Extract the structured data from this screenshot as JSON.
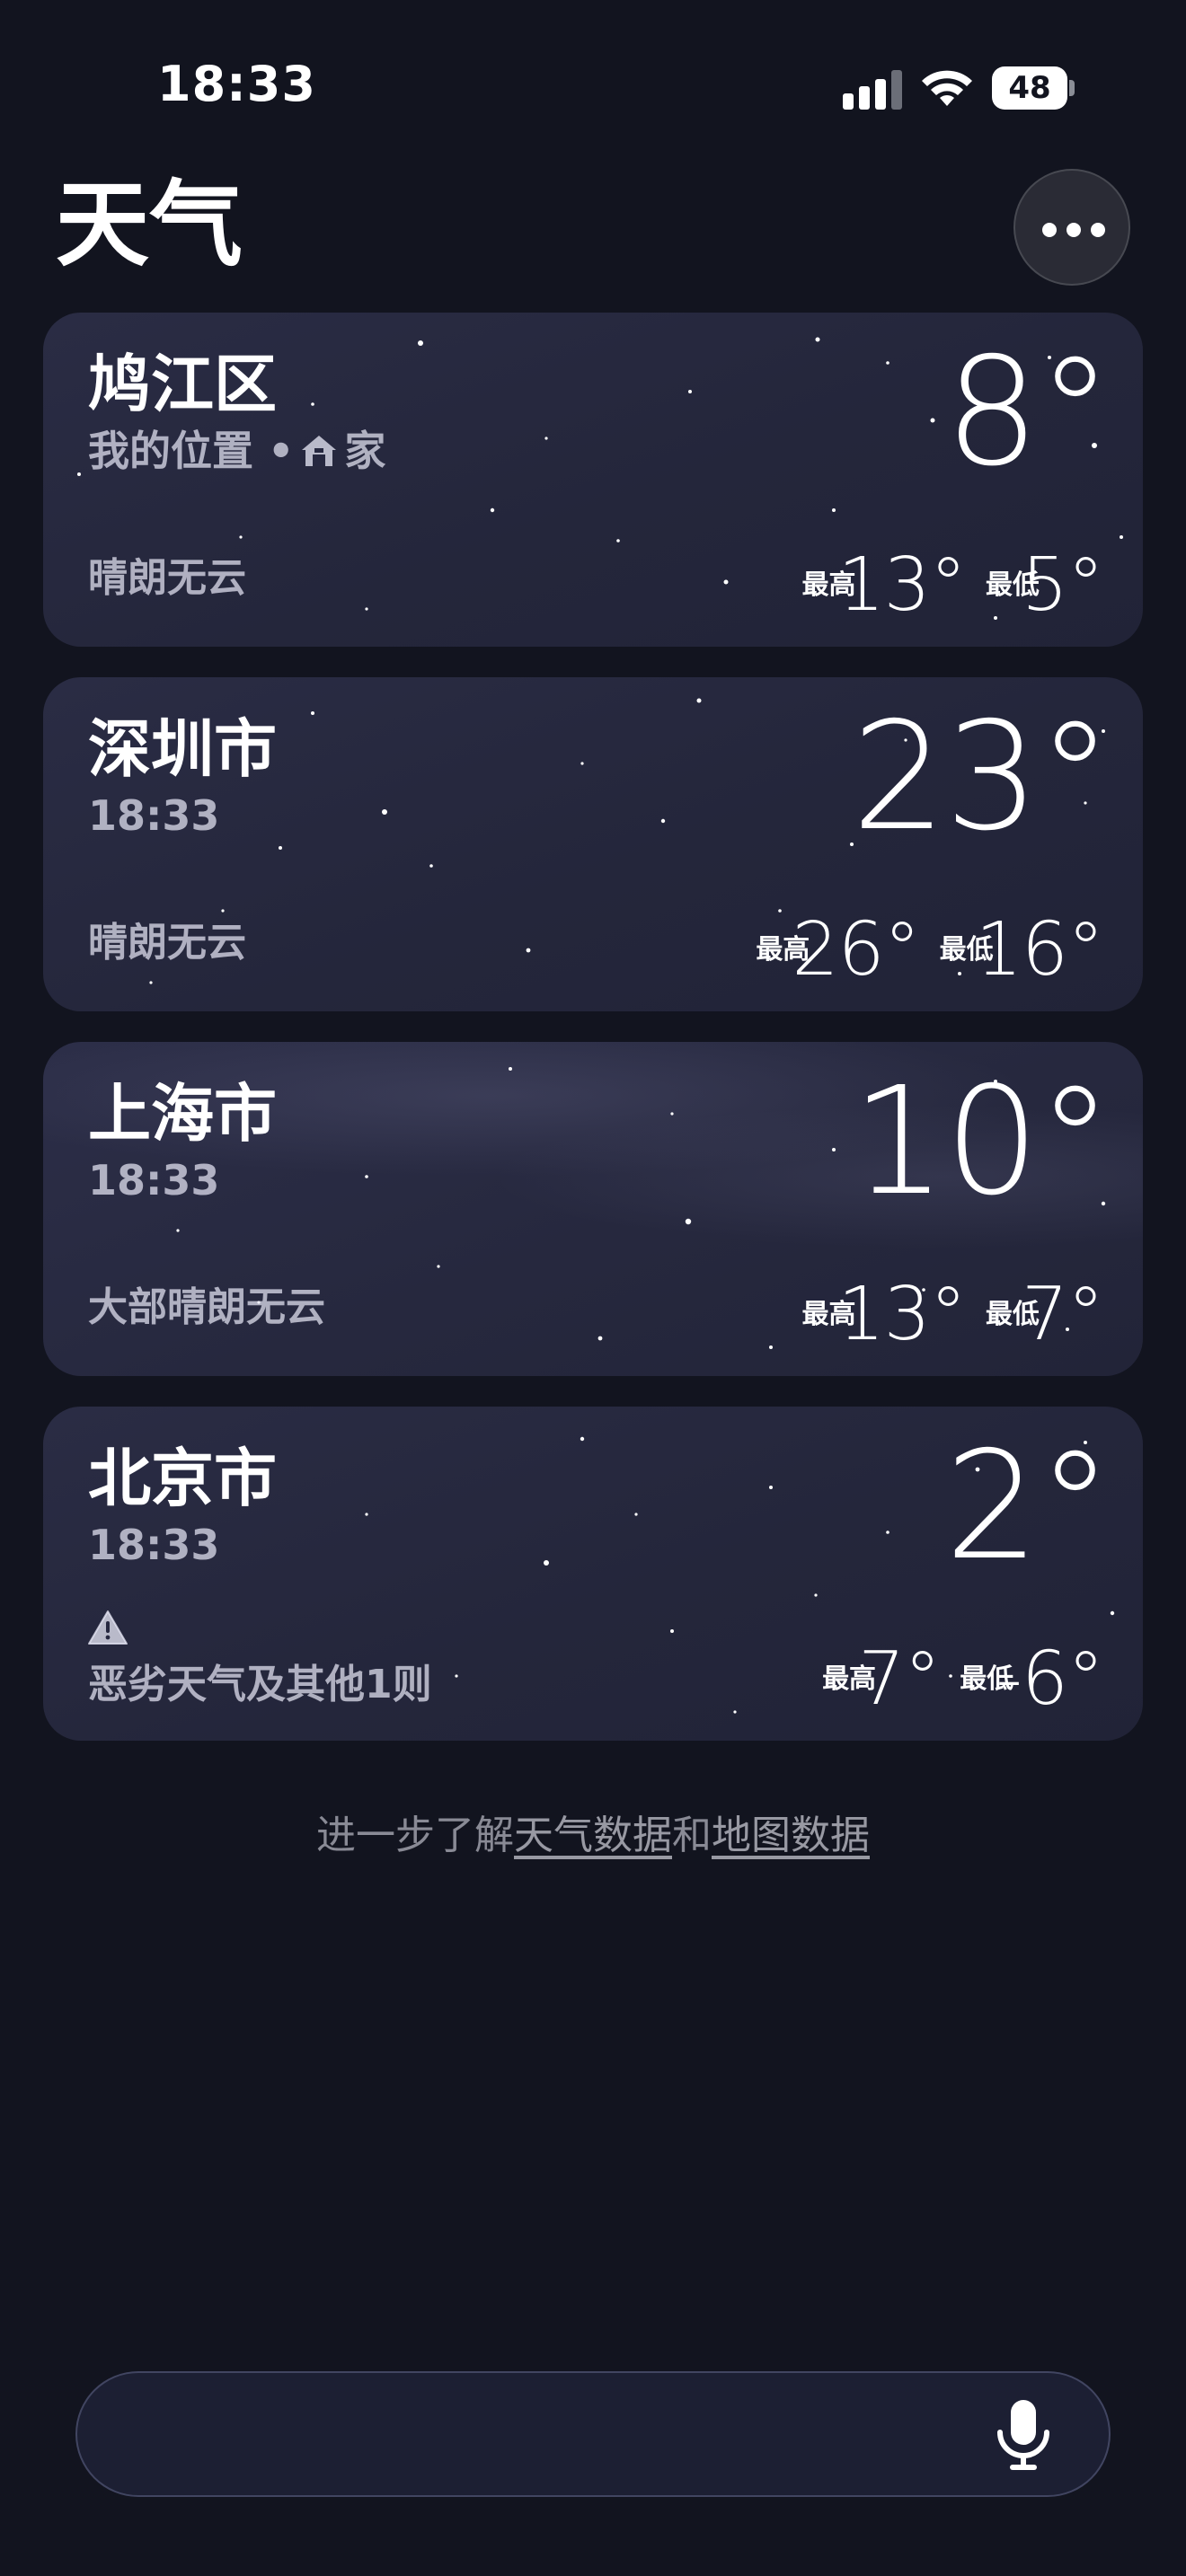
{
  "status_bar": {
    "time": "18:33",
    "battery_level": "48",
    "icons": [
      "signal-icon",
      "wifi-icon",
      "battery-icon"
    ]
  },
  "header": {
    "title": "天气",
    "more_icon": "ellipsis-icon"
  },
  "cards": [
    {
      "city": "鸠江区",
      "subtitle_prefix": "我的位置 •",
      "subtitle_icon": "home-icon",
      "subtitle_suffix": "家",
      "condition": "晴朗无云",
      "temp": "8°",
      "high_label": "最高",
      "high": "13°",
      "low_label": "最低",
      "low": "5°"
    },
    {
      "city": "深圳市",
      "subtitle": "18:33",
      "condition": "晴朗无云",
      "temp": "23°",
      "high_label": "最高",
      "high": "26°",
      "low_label": "最低",
      "low": "16°"
    },
    {
      "city": "上海市",
      "subtitle": "18:33",
      "condition": "大部晴朗无云",
      "temp": "10°",
      "high_label": "最高",
      "high": "13°",
      "low_label": "最低",
      "low": "7°"
    },
    {
      "city": "北京市",
      "subtitle": "18:33",
      "alert_icon": "warning-icon",
      "condition": "恶劣天气及其他1则",
      "temp": "2°",
      "high_label": "最高",
      "high": "7°",
      "low_label": "最低",
      "low": "-6°"
    }
  ],
  "footer": {
    "prefix": "进一步了解",
    "link1": "天气数据",
    "connector": "和",
    "link2": "地图数据"
  },
  "search": {
    "placeholder": "",
    "mic_icon": "microphone-icon"
  }
}
